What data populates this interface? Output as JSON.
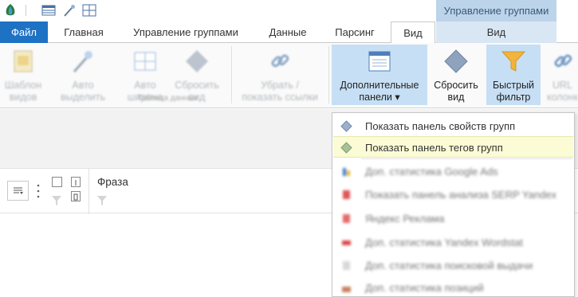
{
  "quick_access": {
    "icons": [
      "app-logo-icon",
      "table-icon",
      "magic-wand-icon",
      "grid-icon"
    ]
  },
  "context_header": {
    "label": "Управление группами"
  },
  "tabs": [
    {
      "label": "Файл"
    },
    {
      "label": "Главная"
    },
    {
      "label": "Управление группами"
    },
    {
      "label": "Данные"
    },
    {
      "label": "Парсинг"
    },
    {
      "label": "Вид"
    },
    {
      "label": "Вид"
    }
  ],
  "ribbon": {
    "faded_buttons": [
      {
        "label_line1": "Шаблон",
        "label_line2": "видов"
      },
      {
        "label_line1": "Авто",
        "label_line2": "выделить"
      },
      {
        "label_line1": "Авто",
        "label_line2": "ширина"
      },
      {
        "label_line1": "Сбросить",
        "label_line2": "вид"
      },
      {
        "label_line1": "Убрать /",
        "label_line2": "показать ссылки"
      }
    ],
    "group_label": "Таблица данных",
    "buttons": [
      {
        "label_line1": "Дополнительные",
        "label_line2": "панели ▾"
      },
      {
        "label_line1": "Сбросить",
        "label_line2": "вид"
      },
      {
        "label_line1": "Быстрый",
        "label_line2": "фильтр"
      },
      {
        "label_line1": "URL",
        "label_line2": "колонки"
      }
    ]
  },
  "grid": {
    "column_title": "Фраза"
  },
  "menu": {
    "items": [
      {
        "label": "Показать панель свойств групп",
        "icon": "diamond-icon"
      },
      {
        "label": "Показать панель тегов групп",
        "icon": "diamond-green-icon"
      },
      {
        "label": "Доп. статистика Google Ads",
        "icon": "google-ads-icon"
      },
      {
        "label": "Показать панель анализа SERP Yandex",
        "icon": "yandex-icon"
      },
      {
        "label": "Яндекс Реклама",
        "icon": "yandex-ads-icon"
      },
      {
        "label": "Доп. статистика Yandex Wordstat",
        "icon": "wordstat-icon"
      },
      {
        "label": "Доп. статистика поисковой выдачи",
        "icon": "serp-icon"
      },
      {
        "label": "Доп. статистика позиций",
        "icon": "positions-icon"
      }
    ]
  },
  "colors": {
    "file_tab": "#1e72c4",
    "context_header": "#bcd4ea",
    "ribbon_highlight": "#c7dff4",
    "menu_hover": "#fbfbd5"
  }
}
